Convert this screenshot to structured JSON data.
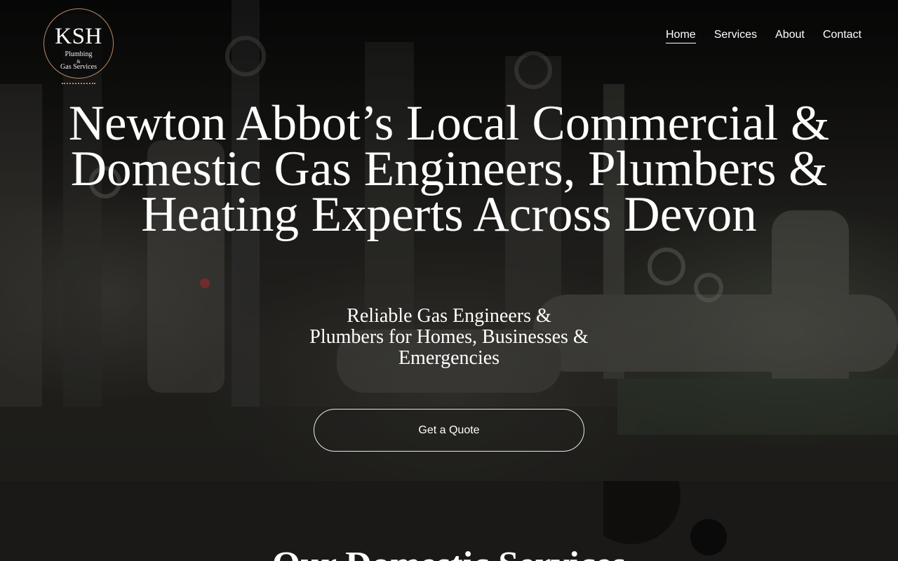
{
  "logo": {
    "initials": "KSH",
    "line1": "Plumbing",
    "amp": "&",
    "line2": "Gas Services"
  },
  "nav": {
    "items": [
      {
        "label": "Home",
        "active": true
      },
      {
        "label": "Services",
        "active": false
      },
      {
        "label": "About",
        "active": false
      },
      {
        "label": "Contact",
        "active": false
      }
    ]
  },
  "hero": {
    "headline": "Newton Abbot’s Local Commercial & Domestic Gas Engineers, Plumbers & Heating Experts Across Devon",
    "subheadline": "Reliable Gas Engineers & Plumbers for Homes, Businesses & Emergencies",
    "cta_label": "Get a Quote"
  },
  "services": {
    "title": "Our Domestic Services"
  },
  "colors": {
    "accent": "#b88a66",
    "section_bg": "#1b1917"
  }
}
